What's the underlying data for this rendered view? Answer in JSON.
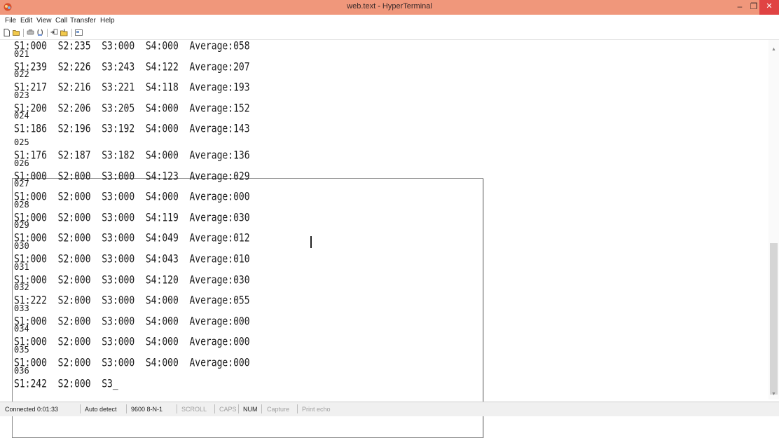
{
  "window": {
    "title": "web.text - HyperTerminal",
    "minimize_glyph": "–",
    "maximize_glyph": "❐",
    "close_glyph": "✕"
  },
  "menu": [
    "File",
    "Edit",
    "View",
    "Call",
    "Transfer",
    "Help"
  ],
  "toolbar": {
    "icons": [
      "new-icon",
      "open-icon",
      "connect-icon",
      "disconnect-icon",
      "send-icon",
      "receive-icon",
      "properties-icon"
    ]
  },
  "terminal": {
    "lines": [
      "S1:000  S2:235  S3:000  S4:000  Average:058",
      "021",
      "S1:239  S2:226  S3:243  S4:122  Average:207",
      "022",
      "S1:217  S2:216  S3:221  S4:118  Average:193",
      "023",
      "S1:200  S2:206  S3:205  S4:000  Average:152",
      "024",
      "S1:186  S2:196  S3:192  S4:000  Average:143",
      "025",
      "S1:176  S2:187  S3:182  S4:000  Average:136",
      "026",
      "S1:000  S2:000  S3:000  S4:123  Average:029",
      "027",
      "S1:000  S2:000  S3:000  S4:000  Average:000",
      "028",
      "S1:000  S2:000  S3:000  S4:119  Average:030",
      "029",
      "S1:000  S2:000  S3:000  S4:049  Average:012",
      "030",
      "S1:000  S2:000  S3:000  S4:043  Average:010",
      "031",
      "S1:000  S2:000  S3:000  S4:120  Average:030",
      "032",
      "S1:222  S2:000  S3:000  S4:000  Average:055",
      "033",
      "S1:000  S2:000  S3:000  S4:000  Average:000",
      "034",
      "S1:000  S2:000  S3:000  S4:000  Average:000",
      "035",
      "S1:000  S2:000  S3:000  S4:000  Average:000",
      "036",
      "S1:242  S2:000  S3_"
    ]
  },
  "statusbar": {
    "connected": "Connected 0:01:33",
    "detect": "Auto detect",
    "settings": "9600 8-N-1",
    "scroll": "SCROLL",
    "caps": "CAPS",
    "num": "NUM",
    "capture": "Capture",
    "print_echo": "Print echo"
  },
  "colors": {
    "titlebar": "#f0977b",
    "close_button": "#e04343"
  }
}
